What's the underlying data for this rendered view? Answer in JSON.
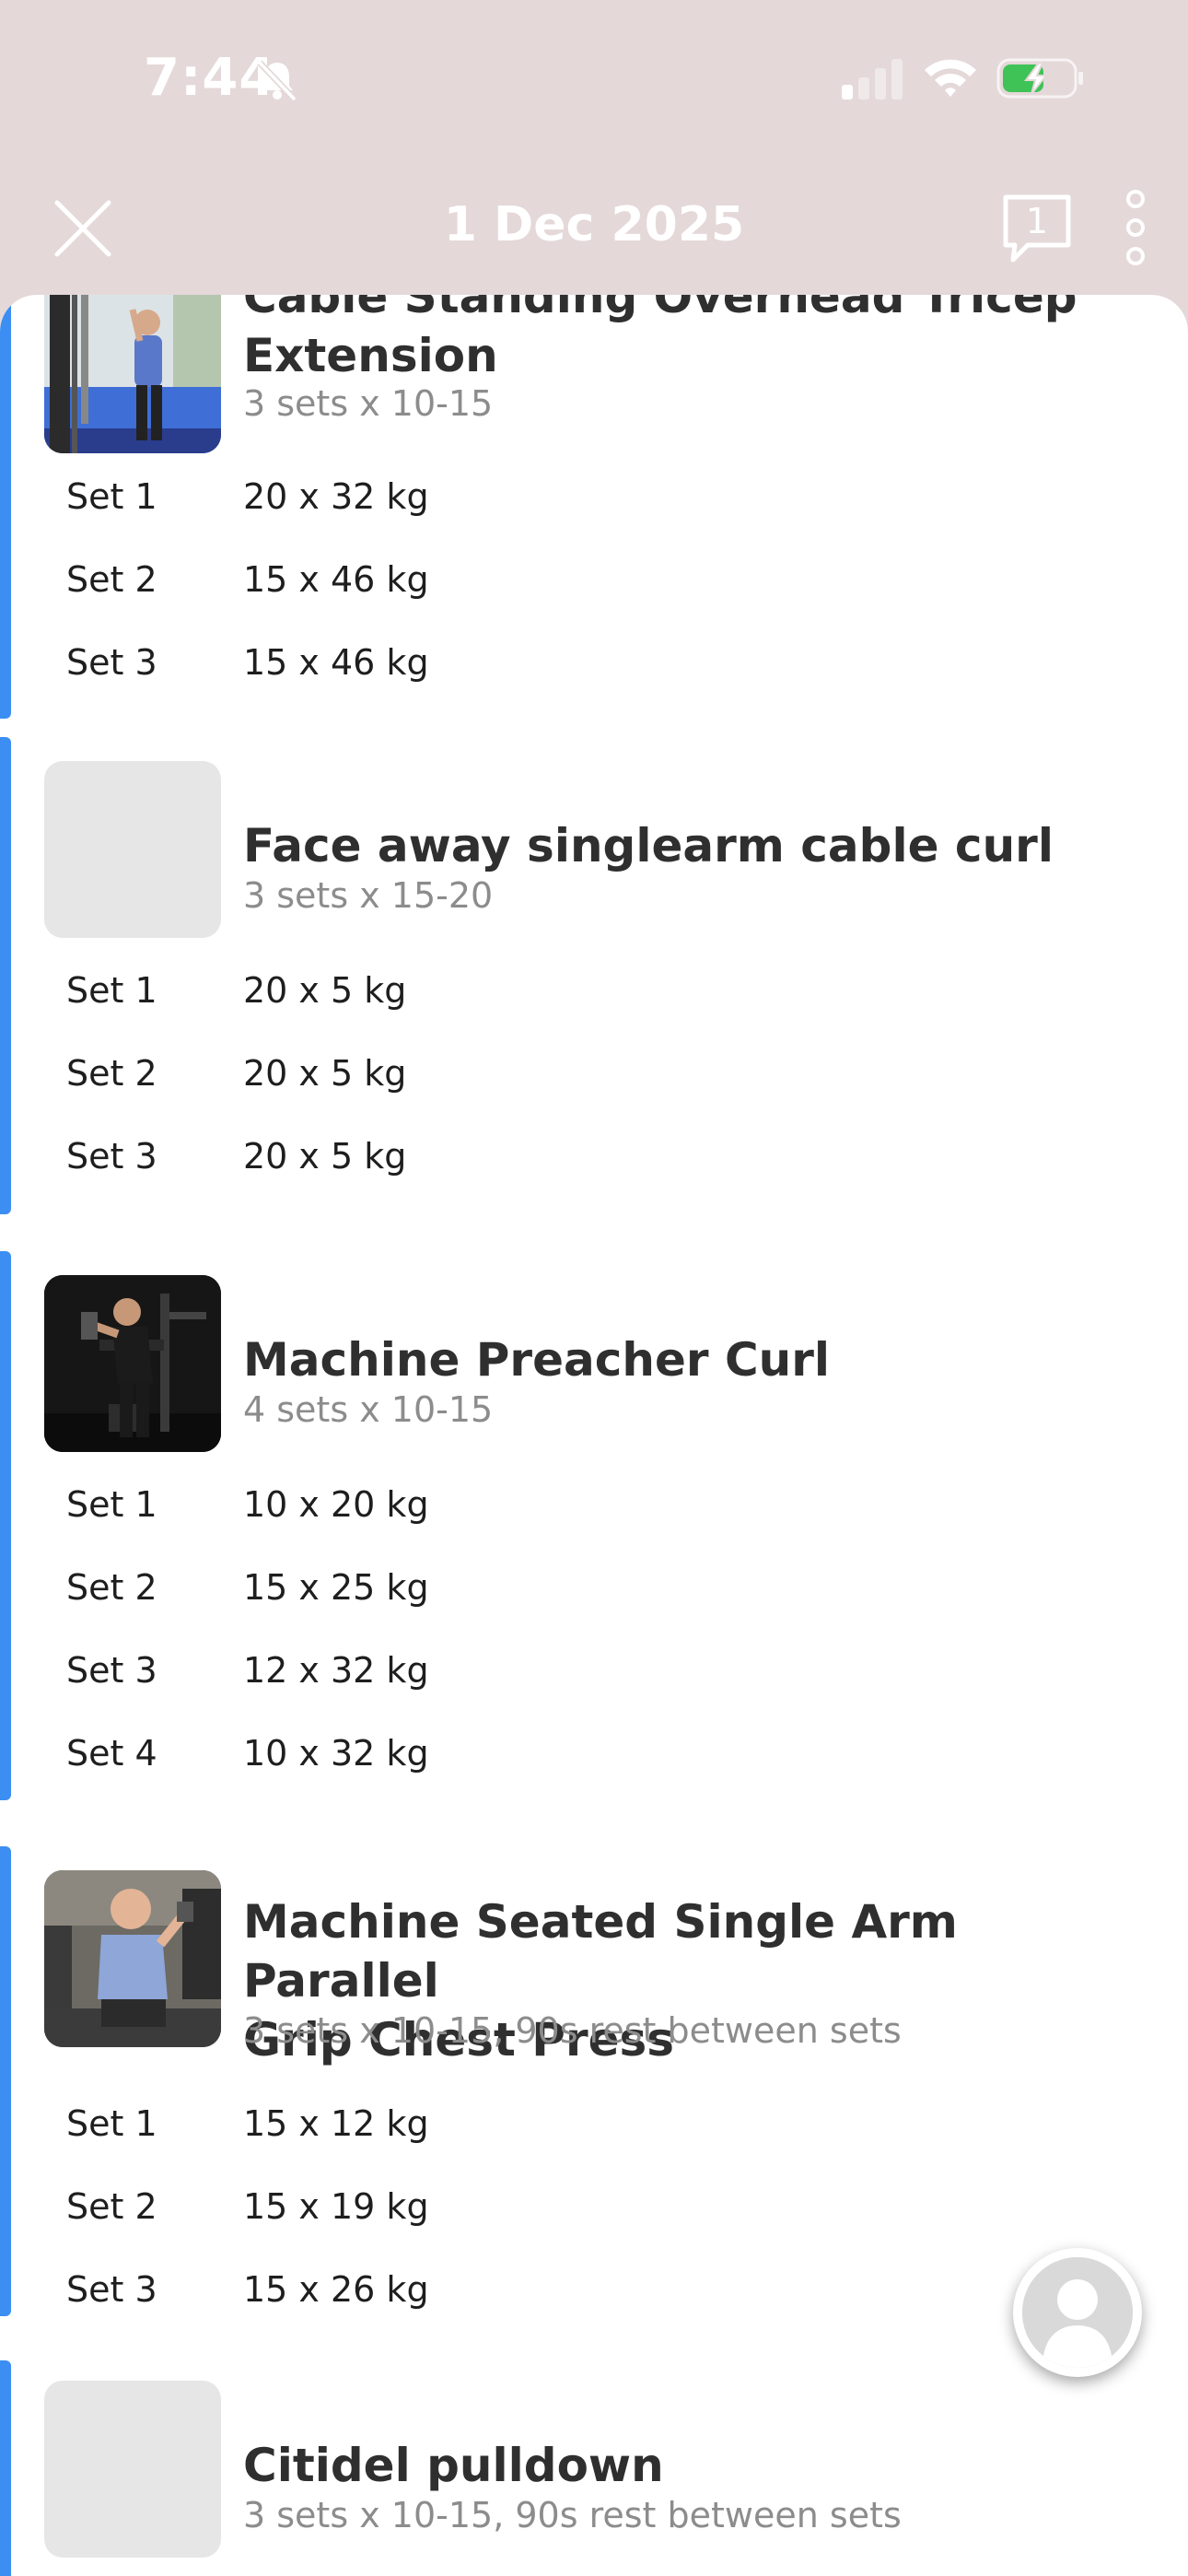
{
  "status_bar": {
    "time": "7:44",
    "icons": [
      "bell-off-icon",
      "signal-icon",
      "wifi-icon",
      "battery-charging-icon"
    ]
  },
  "header": {
    "title": "1 Dec 2025",
    "comments_count": "1",
    "icons": [
      "close-icon",
      "comment-icon",
      "more-vertical-icon"
    ]
  },
  "colors": {
    "background": "#e4d8d9",
    "accent": "#3c8ef3",
    "battery": "#3fc356",
    "title_text": "#2f2f2f",
    "meta_text": "#8c8c8c"
  },
  "exercises": [
    {
      "title_line1": "Cable Standing Overhead Tricep",
      "title_line2": "Extension",
      "meta": "3 sets x 10-15",
      "thumbnail": "photo",
      "sets": [
        {
          "label": "Set 1",
          "value": "20 x 32 kg"
        },
        {
          "label": "Set 2",
          "value": "15 x 46 kg"
        },
        {
          "label": "Set 3",
          "value": "15 x 46 kg"
        }
      ]
    },
    {
      "title_line1": "Face away singlearm cable curl",
      "title_line2": "",
      "meta": "3 sets x 15-20",
      "thumbnail": "placeholder",
      "sets": [
        {
          "label": "Set 1",
          "value": "20 x 5 kg"
        },
        {
          "label": "Set 2",
          "value": "20 x 5 kg"
        },
        {
          "label": "Set 3",
          "value": "20 x 5 kg"
        }
      ]
    },
    {
      "title_line1": "Machine Preacher Curl",
      "title_line2": "",
      "meta": "4 sets x 10-15",
      "thumbnail": "photo",
      "sets": [
        {
          "label": "Set 1",
          "value": "10 x 20 kg"
        },
        {
          "label": "Set 2",
          "value": "15 x 25 kg"
        },
        {
          "label": "Set 3",
          "value": "12 x 32 kg"
        },
        {
          "label": "Set 4",
          "value": "10 x 32 kg"
        }
      ]
    },
    {
      "title_line1": "Machine Seated Single Arm Parallel",
      "title_line2": "Grip Chest Press",
      "meta": "3 sets x 10-15, 90s rest between sets",
      "thumbnail": "photo",
      "sets": [
        {
          "label": "Set 1",
          "value": "15 x 12 kg"
        },
        {
          "label": "Set 2",
          "value": "15 x 19 kg"
        },
        {
          "label": "Set 3",
          "value": "15 x 26 kg"
        }
      ]
    },
    {
      "title_line1": "Citidel pulldown",
      "title_line2": "",
      "meta": "3 sets x 10-15, 90s rest between sets",
      "thumbnail": "placeholder",
      "sets": []
    }
  ],
  "floating_button": {
    "icon": "user-avatar-icon"
  }
}
